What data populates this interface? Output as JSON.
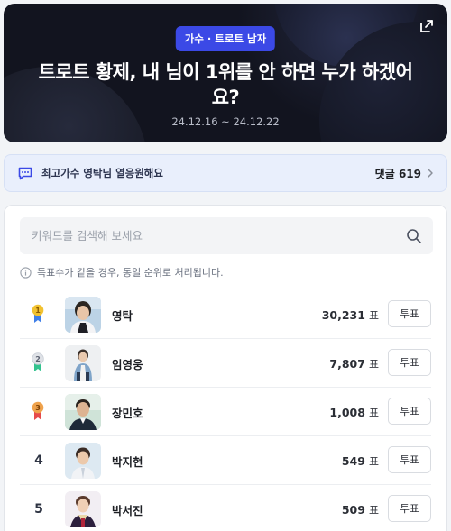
{
  "banner": {
    "category": "가수 · 트로트 남자",
    "title": "트로트 황제, 내 님이 1위를 안 하면 누가 하겠어요?",
    "period": "24.12.16 ~ 24.12.22",
    "share_icon": "share-icon"
  },
  "comment_bar": {
    "text": "최고가수 영탁님 열응원해요",
    "count_label": "댓글",
    "count": "619",
    "icon": "chat-icon"
  },
  "search": {
    "placeholder": "키워드를 검색해 보세요"
  },
  "notice": {
    "text": "득표수가 같을 경우, 동일 순위로 처리됩니다."
  },
  "colors": {
    "badge": "#3b49e6",
    "gold": "#f2c230",
    "silver": "#c9ced6",
    "bronze": "#e8a04b",
    "ribbon": "#3f7fe8"
  },
  "vote_unit": "표",
  "vote_button_label": "투표",
  "rankings": [
    {
      "rank": "1",
      "medal": "gold",
      "name": "영탁",
      "votes": "30,231"
    },
    {
      "rank": "2",
      "medal": "silver",
      "name": "임영웅",
      "votes": "7,807"
    },
    {
      "rank": "3",
      "medal": "bronze",
      "name": "장민호",
      "votes": "1,008"
    },
    {
      "rank": "4",
      "medal": "",
      "name": "박지현",
      "votes": "549"
    },
    {
      "rank": "5",
      "medal": "",
      "name": "박서진",
      "votes": "509"
    }
  ]
}
